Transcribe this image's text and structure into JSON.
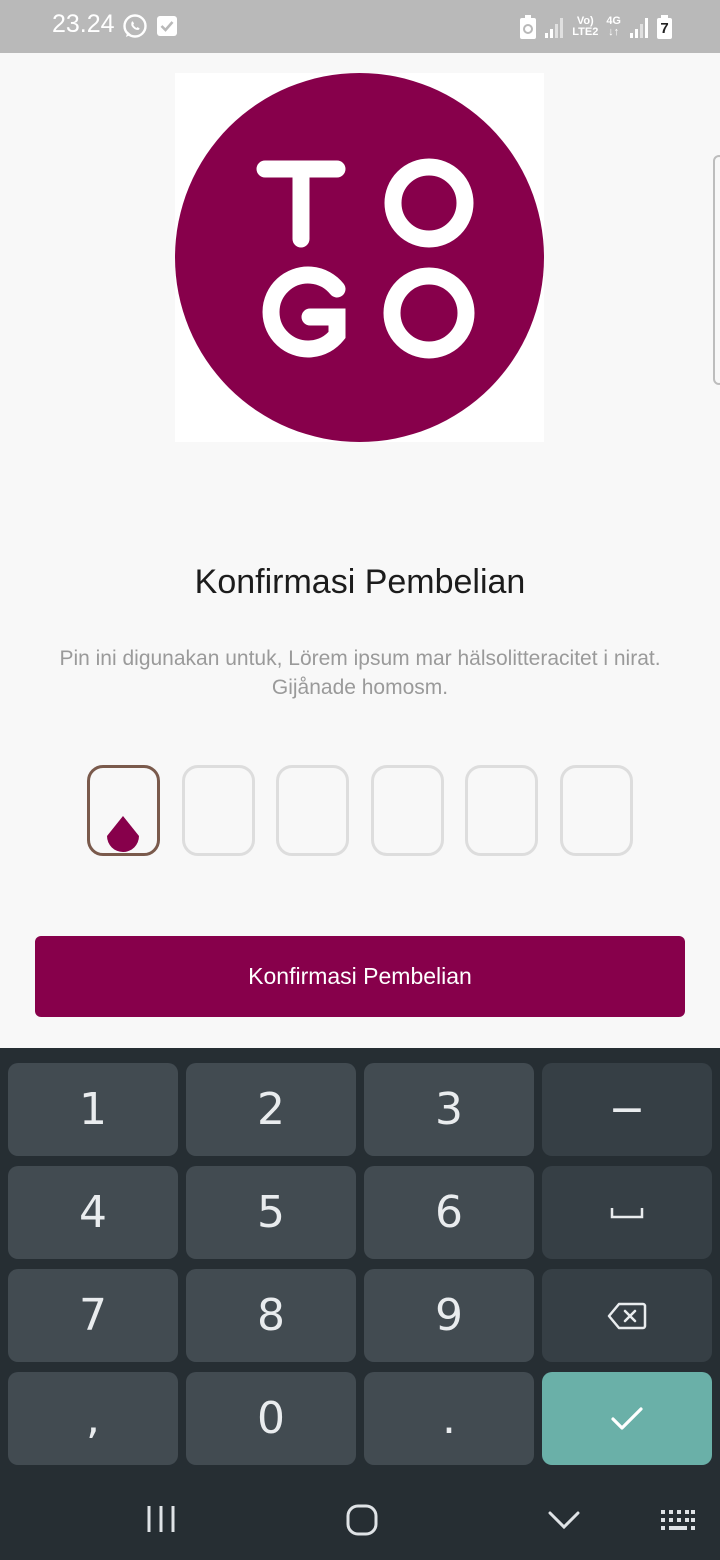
{
  "status_bar": {
    "time": "23.24",
    "network_labels": [
      "Vo)",
      "LTE2",
      "4G"
    ],
    "battery_level": "7"
  },
  "logo": {
    "letters": "TOGO",
    "color": "#87004b"
  },
  "title": "Konfirmasi Pembelian",
  "description": "Pin ini digunakan untuk, Lörem ipsum mar hälsolitteracitet i nirat. Gijånade homosm.",
  "pin": {
    "length": 6,
    "active_index": 0
  },
  "confirm_button": {
    "label": "Konfirmasi Pembelian"
  },
  "keyboard": {
    "keys": [
      {
        "label": "1"
      },
      {
        "label": "2"
      },
      {
        "label": "3"
      },
      {
        "label": "−"
      },
      {
        "label": "4"
      },
      {
        "label": "5"
      },
      {
        "label": "6"
      },
      {
        "label": "space-icon"
      },
      {
        "label": "7"
      },
      {
        "label": "8"
      },
      {
        "label": "9"
      },
      {
        "label": "backspace-icon"
      },
      {
        "label": ","
      },
      {
        "label": "0"
      },
      {
        "label": "."
      },
      {
        "label": "check-icon"
      }
    ]
  },
  "navigation": {
    "icons": [
      "recent-apps-icon",
      "home-icon",
      "back-icon",
      "keyboard-icon"
    ]
  },
  "colors": {
    "brand": "#87004b",
    "keyboard_bg": "#262e33",
    "key": "#424b51",
    "key_ok": "#6ab0a8"
  }
}
